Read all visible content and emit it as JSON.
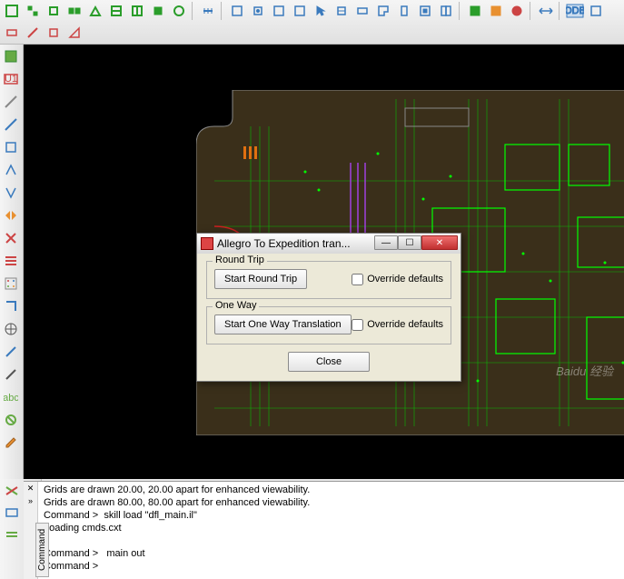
{
  "dialog": {
    "title": "Allegro To Expedition tran...",
    "roundtrip_legend": "Round Trip",
    "roundtrip_button": "Start Round Trip",
    "roundtrip_override": "Override defaults",
    "oneway_legend": "One Way",
    "oneway_button": "Start One Way Translation",
    "oneway_override": "Override defaults",
    "close_button": "Close"
  },
  "console": {
    "tab": "Command",
    "lines": "Grids are drawn 20.00, 20.00 apart for enhanced viewability.\nGrids are drawn 80.00, 80.00 apart for enhanced viewability.\nCommand >  skill load \"dfl_main.il\"\nLoading cmds.cxt\nt\nCommand >   main out\nCommand > "
  },
  "watermark": "Baidu 经验"
}
